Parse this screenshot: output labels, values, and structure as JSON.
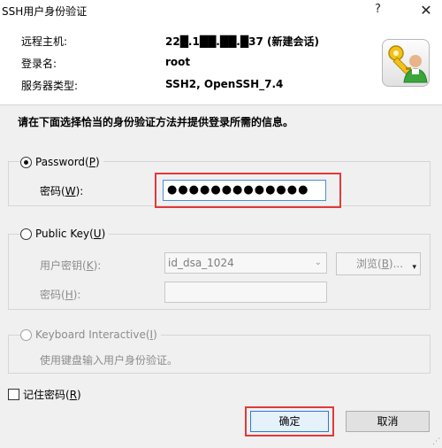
{
  "window": {
    "title": "SSH用户身份验证",
    "help_glyph": "?",
    "close_glyph": "✕"
  },
  "info": {
    "remote_host_label": "远程主机:",
    "remote_host_value": "22█.1██.██.█37 (新建会话)",
    "login_label": "登录名:",
    "login_value": "root",
    "server_type_label": "服务器类型:",
    "server_type_value": "SSH2, OpenSSH_7.4",
    "icon": "key-user-icon"
  },
  "instructions": "请在下面选择恰当的身份验证方法并提供登录所需的信息。",
  "methods": {
    "password": {
      "label": "Password(",
      "key": "P",
      "suffix": ")",
      "field_label": "密码(",
      "field_key": "W",
      "field_suffix": "):",
      "value_masked": "●●●●●●●●●●●●●",
      "selected": true
    },
    "public_key": {
      "label": "Public Key(",
      "key": "U",
      "suffix": ")",
      "user_key_label": "用户密钥(",
      "user_key_key": "K",
      "user_key_suffix": "):",
      "user_key_value": "id_dsa_1024",
      "browse_label": "浏览(",
      "browse_key": "B",
      "browse_suffix": ")...",
      "passphrase_label": "密码(",
      "passphrase_key": "H",
      "passphrase_suffix": "):",
      "selected": false
    },
    "keyboard_interactive": {
      "label": "Keyboard Interactive(",
      "key": "I",
      "suffix": ")",
      "description": "使用键盘输入用户身份验证。",
      "selected": false
    }
  },
  "remember": {
    "label": "记住密码(",
    "key": "R",
    "suffix": ")",
    "checked": false
  },
  "buttons": {
    "ok": "确定",
    "cancel": "取消"
  },
  "colors": {
    "highlight": "#e3393a",
    "focus_border": "#4c8ed4",
    "panel_bg": "#f0f0f0"
  }
}
